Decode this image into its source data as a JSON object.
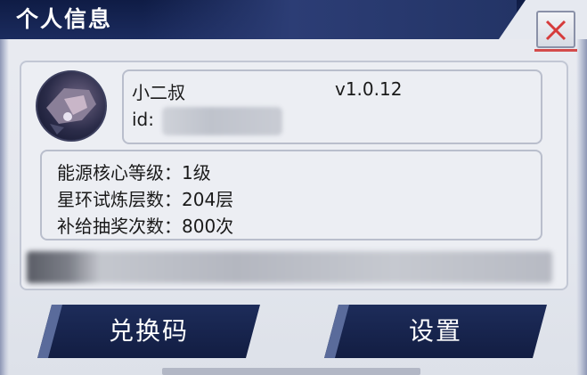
{
  "window": {
    "title": "个人信息"
  },
  "profile": {
    "name": "小二叔",
    "version": "v1.0.12",
    "id_label": "id:"
  },
  "stats": [
    {
      "text": "能源核心等级：1级"
    },
    {
      "text": "星环试炼层数：204层"
    },
    {
      "text": "补给抽奖次数：800次"
    }
  ],
  "buttons": {
    "redeem_label": "兑换码",
    "settings_label": "设置"
  },
  "icons": {
    "close": "close-icon",
    "avatar": "avatar-image"
  },
  "colors": {
    "title_bar": "#1b2b5e",
    "close_x": "#d63b3b",
    "button_bg": "#1d2c5a"
  }
}
